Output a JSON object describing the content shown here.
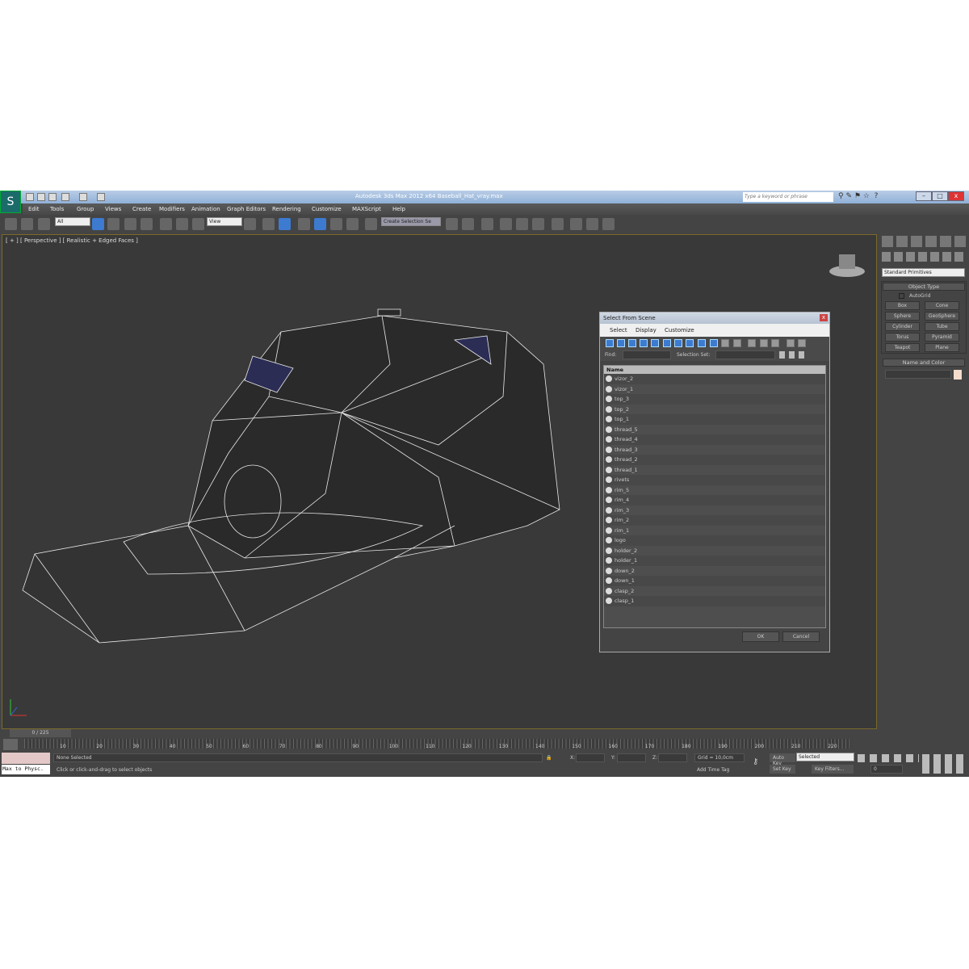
{
  "window": {
    "title": "Autodesk 3ds Max  2012 x64      Baseball_Hat_vray.max",
    "search_placeholder": "Type a keyword or phrase"
  },
  "menu": [
    "Edit",
    "Tools",
    "Group",
    "Views",
    "Create",
    "Modifiers",
    "Animation",
    "Graph Editors",
    "Rendering",
    "Customize",
    "MAXScript",
    "Help"
  ],
  "toolbar": {
    "filter": "All",
    "coord": "View",
    "selection_set": "Create Selection Se"
  },
  "viewport": {
    "label": "[ + ] [ Perspective ] [ Realistic + Edged Faces ]"
  },
  "command_panel": {
    "category": "Standard Primitives",
    "object_type": "Object Type",
    "autogrid": "AutoGrid",
    "buttons": [
      "Box",
      "Cone",
      "Sphere",
      "GeoSphere",
      "Cylinder",
      "Tube",
      "Torus",
      "Pyramid",
      "Teapot",
      "Plane"
    ],
    "name_and_color": "Name and Color",
    "color": "#f5dccb"
  },
  "dialog": {
    "title": "Select From Scene",
    "menu": [
      "Select",
      "Display",
      "Customize"
    ],
    "find_label": "Find:",
    "selection_set_label": "Selection Set:",
    "column": "Name",
    "items": [
      "vizor_2",
      "vizor_1",
      "top_3",
      "top_2",
      "top_1",
      "thread_5",
      "thread_4",
      "thread_3",
      "thread_2",
      "thread_1",
      "rivets",
      "rim_5",
      "rim_4",
      "rim_3",
      "rim_2",
      "rim_1",
      "logo",
      "holder_2",
      "holder_1",
      "down_2",
      "down_1",
      "clasp_2",
      "clasp_1"
    ],
    "ok": "OK",
    "cancel": "Cancel"
  },
  "timeline": {
    "frame": "0 / 225",
    "ticks": [
      "10",
      "20",
      "30",
      "40",
      "50",
      "60",
      "70",
      "80",
      "90",
      "100",
      "110",
      "120",
      "130",
      "140",
      "150",
      "160",
      "170",
      "180",
      "190",
      "200",
      "210",
      "220"
    ]
  },
  "status": {
    "script": "Max to Physc.",
    "selection": "None Selected",
    "prompt": "Click or click-and-drag to select objects",
    "x": "X:",
    "y": "Y:",
    "z": "Z:",
    "grid": "Grid = 10,0cm",
    "add_time_tag": "Add Time Tag",
    "auto_key": "Auto Key",
    "set_key": "Set Key",
    "key_mode": "Selected",
    "key_filters": "Key Filters...",
    "frame_input": "0"
  }
}
